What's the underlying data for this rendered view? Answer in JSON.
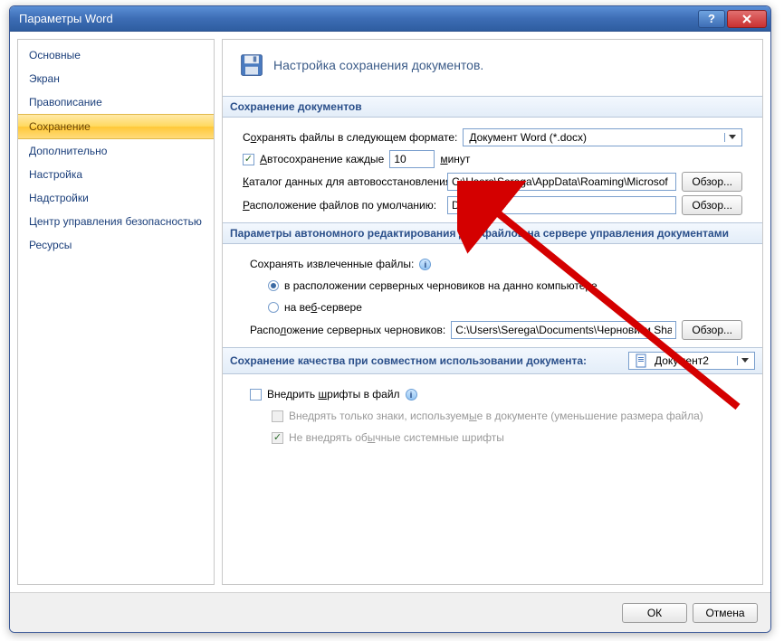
{
  "window": {
    "title": "Параметры Word"
  },
  "sidebar": {
    "items": [
      {
        "label": "Основные"
      },
      {
        "label": "Экран"
      },
      {
        "label": "Правописание"
      },
      {
        "label": "Сохранение"
      },
      {
        "label": "Дополнительно"
      },
      {
        "label": "Настройка"
      },
      {
        "label": "Надстройки"
      },
      {
        "label": "Центр управления безопасностью"
      },
      {
        "label": "Ресурсы"
      }
    ],
    "active_index": 3
  },
  "header": {
    "text": "Настройка сохранения документов."
  },
  "sections": {
    "save_docs": {
      "title": "Сохранение документов",
      "format_label_prefix": "С",
      "format_label_u": "о",
      "format_label_suffix": "хранять файлы в следующем формате:",
      "format_value": "Документ Word (*.docx)",
      "autosave_label_u": "А",
      "autosave_label_suffix": "втосохранение каждые",
      "autosave_value": "10",
      "autosave_unit_u": "м",
      "autosave_unit_suffix": "инут",
      "autorecovery_label_u": "К",
      "autorecovery_label_suffix": "аталог данных для автовосстановления:",
      "autorecovery_value": "C:\\Users\\Serega\\AppData\\Roaming\\Microsof",
      "default_loc_label_u": "Р",
      "default_loc_label_suffix": "асположение файлов по умолчанию:",
      "default_loc_value": "D:\\",
      "browse_label": "Обзор..."
    },
    "offline": {
      "title": "Параметры автономного редактирования для файлов на сервере управления документами",
      "extracted_label": "Сохранять извлеченные файлы:",
      "opt1_prefix": "в расположении серверных черновиков на данно",
      "opt1_suffix": " компьютере",
      "opt2_prefix": "на ве",
      "opt2_u": "б",
      "opt2_suffix": "-сервере",
      "drafts_label_prefix": "Распо",
      "drafts_label_u": "л",
      "drafts_label_suffix": "ожение серверных черновиков:",
      "drafts_value": "C:\\Users\\Serega\\Documents\\Черновики Share",
      "browse_label": "Обзор..."
    },
    "quality": {
      "title": "Сохранение качества при совместном использовании документа:",
      "doc_name": "Документ2",
      "embed_label_prefix": "Внедрить ",
      "embed_label_u": "ш",
      "embed_label_suffix": "рифты в файл",
      "sub1_prefix": "Внедрять только знаки, используем",
      "sub1_u": "ы",
      "sub1_suffix": "е в документе (уменьшение размера файла)",
      "sub2_prefix": "Не внедрять об",
      "sub2_u": "ы",
      "sub2_suffix": "чные системные шрифты"
    }
  },
  "footer": {
    "ok": "ОК",
    "cancel": "Отмена"
  }
}
